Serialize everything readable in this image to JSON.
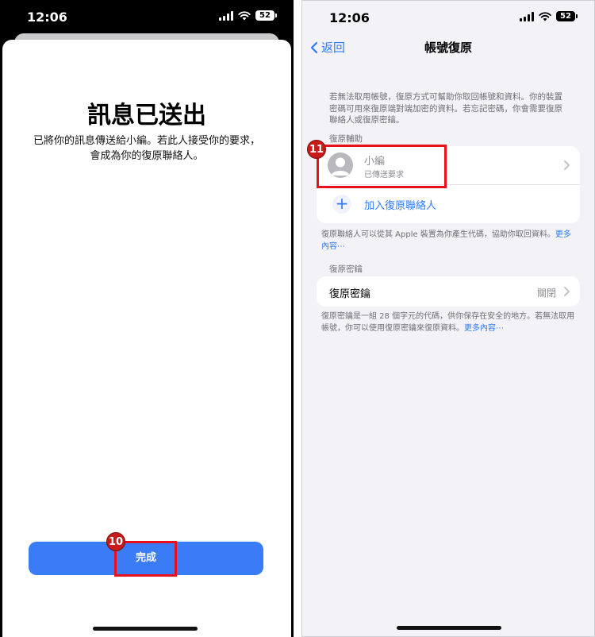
{
  "left": {
    "status_time": "12:06",
    "battery": "52",
    "title": "訊息已送出",
    "description": "已將你的訊息傳送給小編。若此人接受你的要求，會成為你的復原聯絡人。",
    "done_label": "完成",
    "step_badge": "10"
  },
  "right": {
    "status_time": "12:06",
    "battery": "52",
    "back_label": "返回",
    "nav_title": "帳號復原",
    "intro": "若無法取用帳號，復原方式可幫助你取回帳號和資料。你的裝置密碼可用來復原端對端加密的資料。若忘記密碼，你會需要復原聯絡人或復原密鑰。",
    "section_assist": "復原輔助",
    "contact_name": "小編",
    "contact_status": "已傳送要求",
    "add_contact_label": "加入復原聯絡人",
    "assist_footer": "復原聯絡人可以從其 Apple 裝置為你產生代碼，協助你取回資料。",
    "assist_footer_link": "更多內容⋯",
    "section_key": "復原密鑰",
    "key_row_label": "復原密鑰",
    "key_row_value": "關閉",
    "key_footer": "復原密鑰是一組 28 個字元的代碼，供你保存在安全的地方。若無法取用帳號，你可以使用復原密鑰來復原資料。",
    "key_footer_link": "更多內容⋯",
    "step_badge": "11"
  },
  "colors": {
    "accent": "#2f7bf6",
    "button": "#3a7cf5",
    "annotation": "#e8101a"
  },
  "icons": [
    "signal-icon",
    "wifi-icon",
    "battery-icon",
    "back-chevron-icon",
    "avatar-icon",
    "plus-icon",
    "chevron-right-icon"
  ]
}
